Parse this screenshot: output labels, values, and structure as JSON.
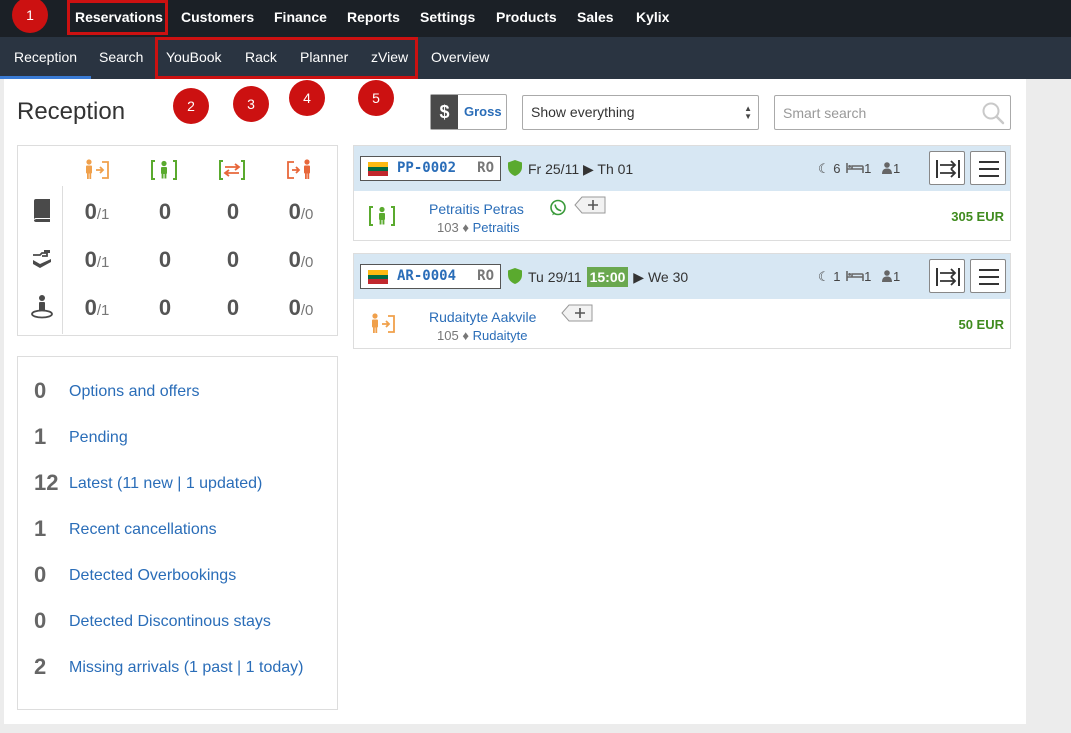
{
  "top_nav": [
    "Reservations",
    "Customers",
    "Finance",
    "Reports",
    "Settings",
    "Products",
    "Sales",
    "Kylix"
  ],
  "sub_nav": [
    "Reception",
    "Search",
    "YouBook",
    "Rack",
    "Planner",
    "zView",
    "Overview"
  ],
  "page": {
    "title": "Reception"
  },
  "toolbar": {
    "currency_symbol": "$",
    "gross_label": "Gross",
    "filter_value": "Show everything",
    "search_placeholder": "Smart search"
  },
  "stats": {
    "column_icons": [
      "arrival-icon",
      "in-house-icon",
      "room-move-icon",
      "departure-icon"
    ],
    "row_icons": [
      "book-icon",
      "service-hand-icon",
      "guest-person-icon"
    ],
    "rows": [
      {
        "cells": [
          {
            "main": "0",
            "sub": "/1"
          },
          {
            "main": "0",
            "sub": ""
          },
          {
            "main": "0",
            "sub": ""
          },
          {
            "main": "0",
            "sub": "/0"
          }
        ]
      },
      {
        "cells": [
          {
            "main": "0",
            "sub": "/1"
          },
          {
            "main": "0",
            "sub": ""
          },
          {
            "main": "0",
            "sub": ""
          },
          {
            "main": "0",
            "sub": "/0"
          }
        ]
      },
      {
        "cells": [
          {
            "main": "0",
            "sub": "/1"
          },
          {
            "main": "0",
            "sub": ""
          },
          {
            "main": "0",
            "sub": ""
          },
          {
            "main": "0",
            "sub": "/0"
          }
        ]
      }
    ]
  },
  "summary": [
    {
      "count": "0",
      "label": "Options and offers"
    },
    {
      "count": "1",
      "label": "Pending"
    },
    {
      "count": "12",
      "label": "Latest (11 new | 1 updated)"
    },
    {
      "count": "1",
      "label": "Recent cancellations"
    },
    {
      "count": "0",
      "label": "Detected Overbookings"
    },
    {
      "count": "0",
      "label": "Detected Discontinous stays"
    },
    {
      "count": "2",
      "label": "Missing arrivals (1 past | 1 today)"
    }
  ],
  "reservations": [
    {
      "code": "PP-0002",
      "country": "RO",
      "from": "Fr 25/11",
      "time": "",
      "to": "Th 01",
      "nights": "6",
      "rooms": "1",
      "persons": "1",
      "guest": "Petraitis Petras",
      "room_number": "103",
      "room_name": "Petraitis",
      "price": "305 EUR",
      "status_icon": "in-house-icon",
      "has_whatsapp": true
    },
    {
      "code": "AR-0004",
      "country": "RO",
      "from": "Tu 29/11",
      "time": "15:00",
      "to": "We 30",
      "nights": "1",
      "rooms": "1",
      "persons": "1",
      "guest": "Rudaityte Aakvile",
      "room_number": "105",
      "room_name": "Rudaityte",
      "price": "50 EUR",
      "status_icon": "arrival-icon",
      "has_whatsapp": false
    }
  ],
  "annotations": [
    "1",
    "2",
    "3",
    "4",
    "5"
  ],
  "colors": {
    "top_nav_bg": "#1b2026",
    "sub_nav_bg": "#2a3441",
    "link": "#2a6db8",
    "price": "#3f8b1e",
    "annotation": "#cc1111",
    "arrival": "#f0a04b",
    "in_house": "#5aaa2e",
    "departure": "#e8673a"
  }
}
